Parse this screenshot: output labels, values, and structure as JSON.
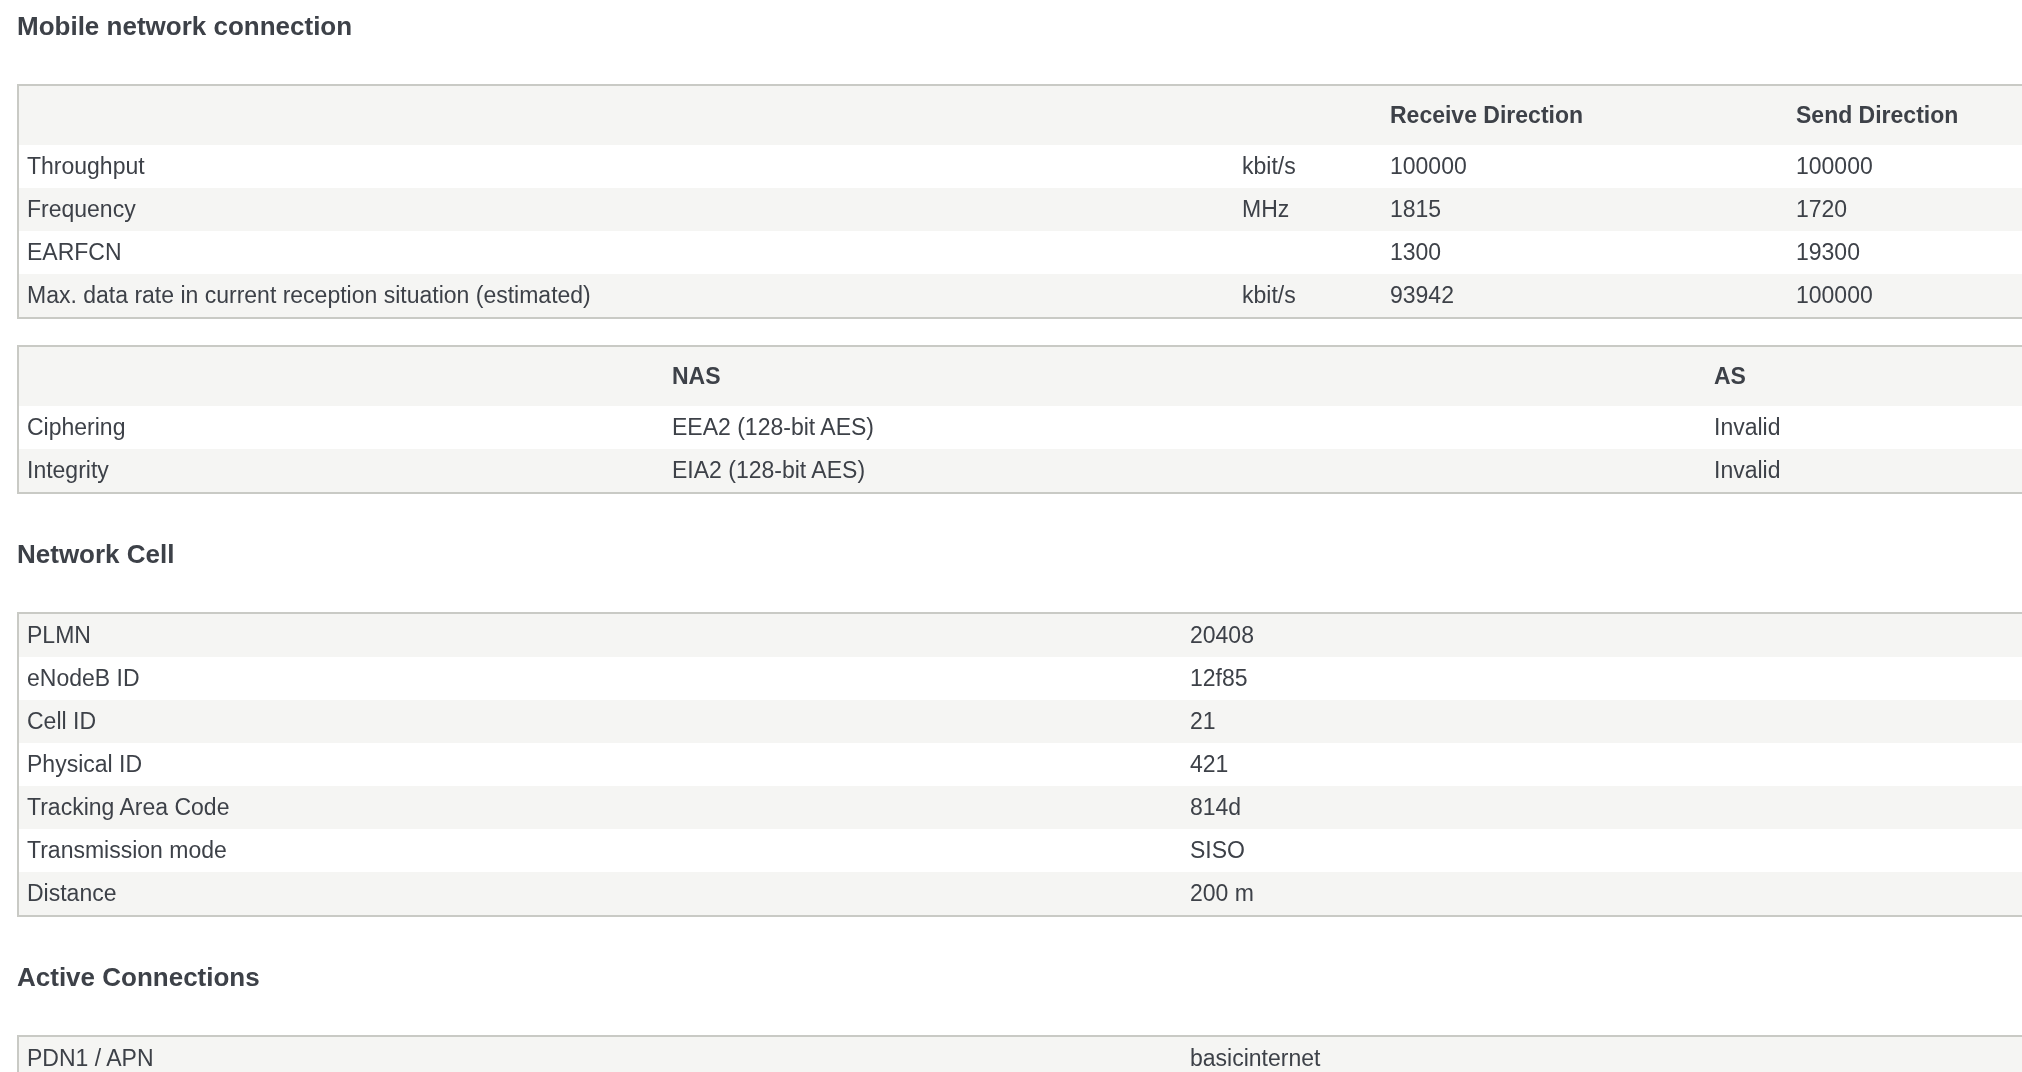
{
  "sections": [
    {
      "heading": "Mobile network connection",
      "tables": [
        {
          "kind": "directions",
          "headers": {
            "receive": "Receive Direction",
            "send": "Send Direction"
          },
          "rows": [
            {
              "label": "Throughput",
              "unit": "kbit/s",
              "receive": "100000",
              "send": "100000"
            },
            {
              "label": "Frequency",
              "unit": "MHz",
              "receive": "1815",
              "send": "1720"
            },
            {
              "label": "EARFCN",
              "receive": "1300",
              "send": "19300"
            },
            {
              "label": "Max. data rate in current reception situation (estimated)",
              "unit": "kbit/s",
              "receive": "93942",
              "send": "100000"
            }
          ]
        },
        {
          "kind": "security",
          "headers": {
            "nas": "NAS",
            "as": "AS"
          },
          "rows": [
            {
              "label": "Ciphering",
              "nas": "EEA2 (128-bit AES)",
              "as": "Invalid"
            },
            {
              "label": "Integrity",
              "nas": "EIA2 (128-bit AES)",
              "as": "Invalid"
            }
          ]
        }
      ]
    },
    {
      "heading": "Network Cell",
      "tables": [
        {
          "kind": "key_value",
          "rows": [
            {
              "label": "PLMN",
              "value": "20408"
            },
            {
              "label": "eNodeB ID",
              "value": "12f85"
            },
            {
              "label": "Cell ID",
              "value": "21"
            },
            {
              "label": "Physical ID",
              "value": "421"
            },
            {
              "label": "Tracking Area Code",
              "value": "814d"
            },
            {
              "label": "Transmission mode",
              "value": "SISO"
            },
            {
              "label": "Distance",
              "value": "200 m"
            }
          ]
        }
      ]
    },
    {
      "heading": "Active Connections",
      "tables": [
        {
          "kind": "key_value",
          "rows": [
            {
              "label": "PDN1 / APN",
              "value": "basicinternet"
            }
          ]
        }
      ]
    }
  ]
}
